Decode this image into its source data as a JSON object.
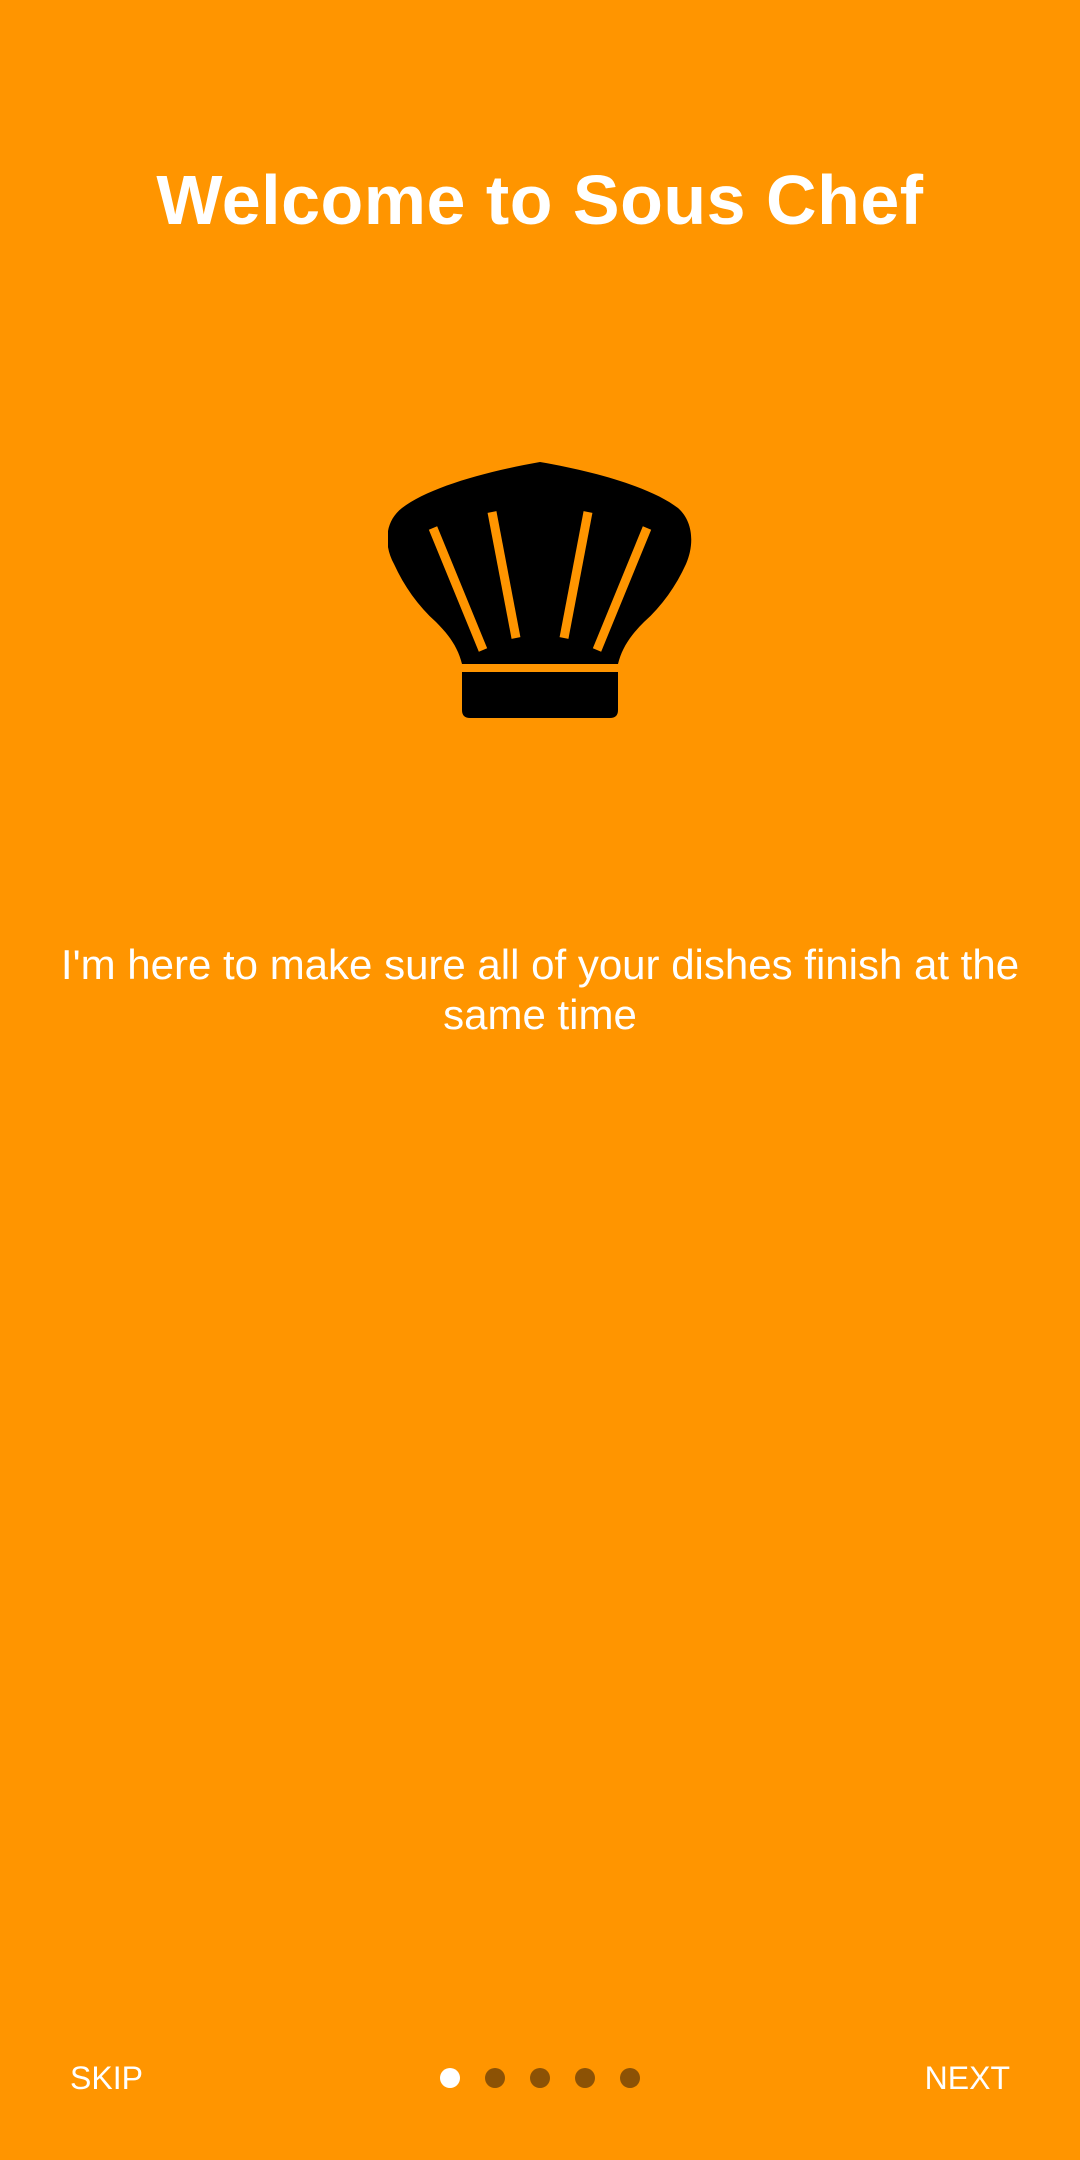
{
  "onboarding": {
    "title": "Welcome to Sous Chef",
    "description": "I'm here to make sure all of your dishes finish at the same time",
    "hero_icon": "chef-hat-icon"
  },
  "navigation": {
    "skip_label": "SKIP",
    "next_label": "NEXT",
    "page_indicator": {
      "current_page": 1,
      "total_pages": 5
    }
  },
  "colors": {
    "background": "#FF9500",
    "text": "#FFFFFF",
    "icon": "#000000",
    "dot_active": "#FFFFFF",
    "dot_inactive": "#8C5205"
  }
}
